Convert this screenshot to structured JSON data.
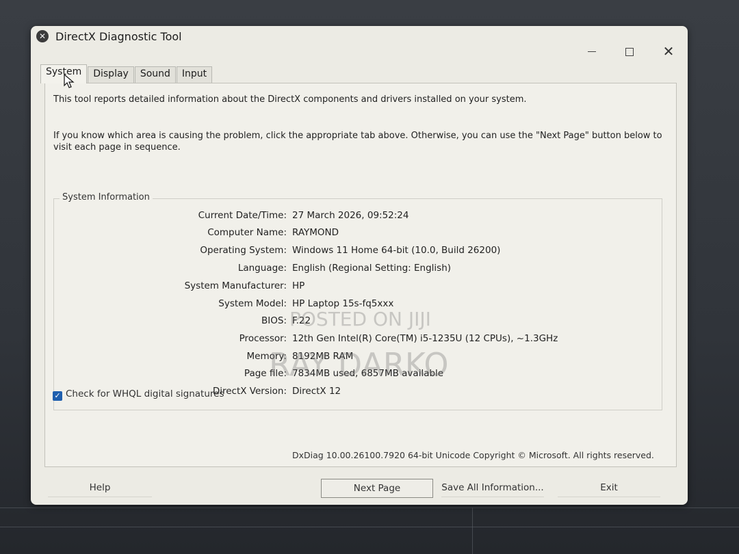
{
  "window": {
    "title": "DirectX Diagnostic Tool",
    "close_glyph": "✕"
  },
  "tabs": [
    {
      "label": "System",
      "active": true
    },
    {
      "label": "Display",
      "active": false
    },
    {
      "label": "Sound",
      "active": false
    },
    {
      "label": "Input",
      "active": false
    }
  ],
  "intro": {
    "line1": "This tool reports detailed information about the DirectX components and drivers installed on your system.",
    "line2": "If you know which area is causing the problem, click the appropriate tab above.  Otherwise, you can use the \"Next Page\" button below to visit each page in sequence."
  },
  "system_info": {
    "group_title": "System Information",
    "rows": [
      {
        "label": "Current Date/Time:",
        "value": "27 March 2026, 09:52:24"
      },
      {
        "label": "Computer Name:",
        "value": "RAYMOND"
      },
      {
        "label": "Operating System:",
        "value": "Windows 11 Home 64-bit (10.0, Build 26200)"
      },
      {
        "label": "Language:",
        "value": "English (Regional Setting: English)"
      },
      {
        "label": "System Manufacturer:",
        "value": "HP"
      },
      {
        "label": "System Model:",
        "value": "HP Laptop 15s-fq5xxx"
      },
      {
        "label": "BIOS:",
        "value": "F.22"
      },
      {
        "label": "Processor:",
        "value": "12th Gen Intel(R) Core(TM) i5-1235U (12 CPUs), ~1.3GHz"
      },
      {
        "label": "Memory:",
        "value": "8192MB RAM"
      },
      {
        "label": "Page file:",
        "value": "7834MB used, 6857MB available"
      },
      {
        "label": "DirectX Version:",
        "value": "DirectX 12"
      }
    ]
  },
  "whql": {
    "label": "Check for WHQL digital signatures",
    "checked": true
  },
  "version_text": "DxDiag 10.00.26100.7920 64-bit Unicode  Copyright © Microsoft. All rights reserved.",
  "buttons": {
    "help": "Help",
    "next": "Next Page",
    "save": "Save All Information...",
    "exit": "Exit"
  },
  "watermark": {
    "line1": "POSTED ON JIJI",
    "line2": "RAY DARKO"
  },
  "colors": {
    "accent": "#1f5fae",
    "window_bg": "#ecebe4"
  }
}
